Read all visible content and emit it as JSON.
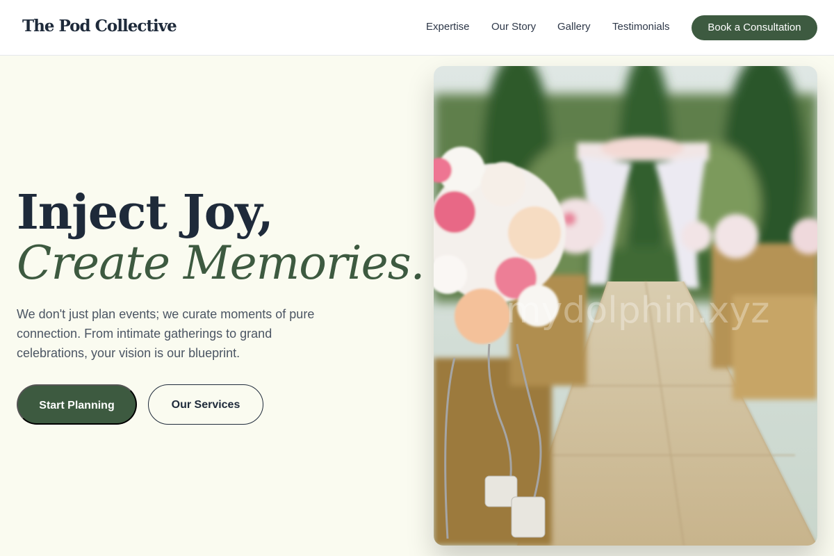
{
  "header": {
    "logo": "The Pod Collective",
    "nav": [
      "Expertise",
      "Our Story",
      "Gallery",
      "Testimonials"
    ],
    "cta_label": "Book a Consultation"
  },
  "hero": {
    "headline_line1": "Inject Joy,",
    "headline_line2": "Create Memories.",
    "subtext": "We don't just plan events; we curate moments of pure connection. From intimate gatherings to grand celebrations, your vision is our blueprint.",
    "primary_button": "Start Planning",
    "secondary_button": "Our Services",
    "image_watermark": "mydolphin.xyz"
  },
  "colors": {
    "accent": "#3d5a40",
    "background": "#fafbf0",
    "heading": "#1e2a3a"
  }
}
